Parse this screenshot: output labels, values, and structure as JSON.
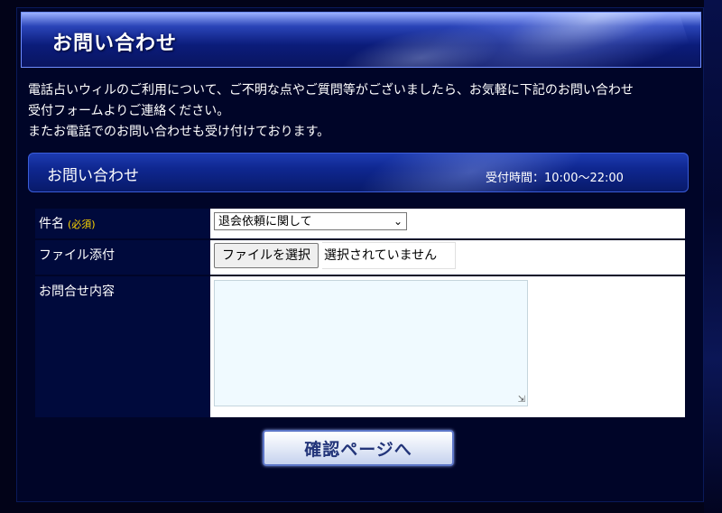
{
  "header": {
    "title": "お問い合わせ"
  },
  "intro": {
    "line1": "電話占いウィルのご利用について、ご不明な点やご質問等がございましたら、お気軽に下記のお問い合わせ",
    "line2": "受付フォームよりご連絡ください。",
    "line3": "またお電話でのお問い合わせも受け付けております。"
  },
  "section": {
    "title": "お問い合わせ",
    "hours": "受付時間：10:00～22:00"
  },
  "form": {
    "subject": {
      "label": "件名",
      "required": "(必須)",
      "selected": "退会依頼に関して"
    },
    "attachment": {
      "label": "ファイル添付",
      "button": "ファイルを選択",
      "status": "選択されていません"
    },
    "message": {
      "label": "お問合せ内容",
      "value": ""
    }
  },
  "submit": {
    "label": "確認ページへ"
  }
}
